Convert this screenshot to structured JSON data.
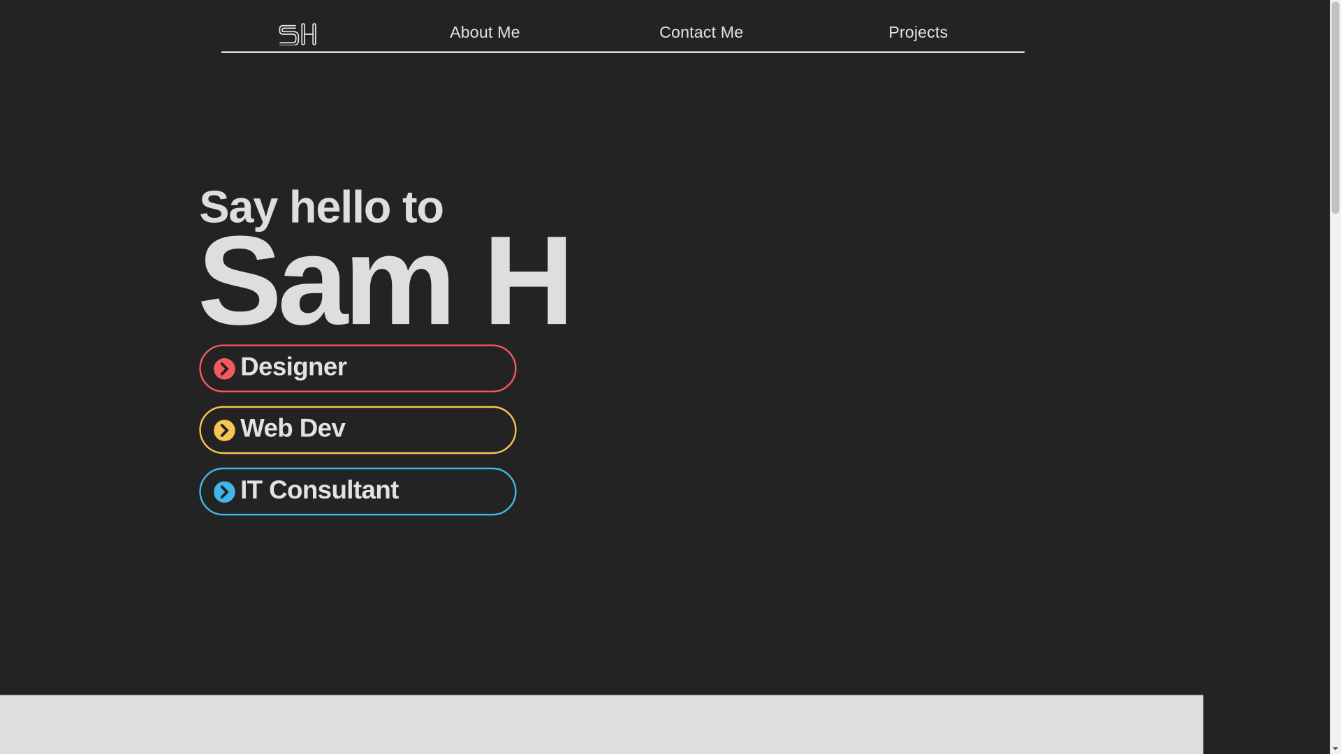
{
  "nav": {
    "logo_text": "SH",
    "links": [
      {
        "label": "About Me"
      },
      {
        "label": "Contact Me"
      },
      {
        "label": "Projects"
      }
    ]
  },
  "hero": {
    "greeting": "Say hello to",
    "name": "Sam H"
  },
  "roles": [
    {
      "label": "Designer",
      "color": "#f35a5f",
      "icon": "chevron-right-circle-icon"
    },
    {
      "label": "Web Dev",
      "color": "#f6c650",
      "icon": "chevron-right-circle-icon"
    },
    {
      "label": "IT Consultant",
      "color": "#41b6ea",
      "icon": "chevron-right-circle-icon"
    }
  ],
  "colors": {
    "background": "#232323",
    "text": "#dedede",
    "footer_strip": "#dedede"
  }
}
